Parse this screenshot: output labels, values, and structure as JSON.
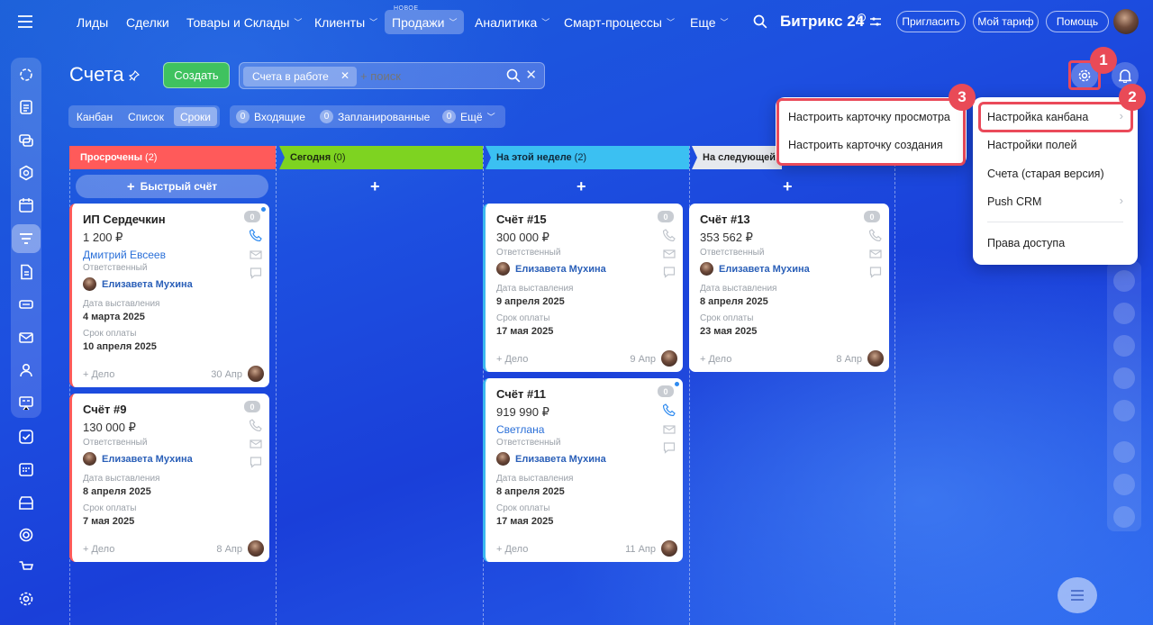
{
  "topnav": {
    "items": [
      {
        "label": "Лиды",
        "chev": ""
      },
      {
        "label": "Сделки",
        "chev": ""
      },
      {
        "label": "Товары и Склады",
        "chev": "﹀"
      },
      {
        "label": "Клиенты",
        "chev": "﹀"
      },
      {
        "label": "Продажи",
        "chev": "﹀"
      },
      {
        "label": "Аналитика",
        "chev": "﹀"
      },
      {
        "label": "Смарт-процессы",
        "chev": "﹀"
      },
      {
        "label": "Еще",
        "chev": "﹀"
      }
    ],
    "new_badge": "НОВОЕ",
    "brand": "Битрикс 24",
    "invite": "Пригласить",
    "tariff": "Мой тариф",
    "help": "Помощь"
  },
  "header": {
    "title": "Счета",
    "create": "Создать",
    "filter_chip": "Счета в работе",
    "search_placeholder": "+ поиск"
  },
  "views": [
    "Канбан",
    "Список",
    "Сроки"
  ],
  "counters": [
    {
      "num": "0",
      "label": "Входящие"
    },
    {
      "num": "0",
      "label": "Запланированные"
    },
    {
      "num": "0",
      "label": "Ещё"
    }
  ],
  "stages": [
    {
      "name": "Просрочены",
      "count": "(2)"
    },
    {
      "name": "Сегодня",
      "count": "(0)"
    },
    {
      "name": "На этой неделе",
      "count": "(2)"
    },
    {
      "name": "На следующей",
      "count": ""
    }
  ],
  "quick_invoice": "Быстрый счёт",
  "labels": {
    "responsible": "Ответственный",
    "issue_date": "Дата выставления",
    "due_date": "Срок оплаты",
    "add_task": "+ Дело"
  },
  "cards": [
    {
      "title": "ИП Сердечкин",
      "badge": "0",
      "sum": "1 200 ₽",
      "client": "Дмитрий Евсеев",
      "resp": "Елизавета Мухина",
      "issue": "4 марта 2025",
      "due": "10 апреля 2025",
      "foot": "30 Апр"
    },
    {
      "title": "Счёт #9",
      "badge": "0",
      "sum": "130 000 ₽",
      "client": "",
      "resp": "Елизавета Мухина",
      "issue": "8 апреля 2025",
      "due": "7 мая 2025",
      "foot": "8 Апр"
    },
    {
      "title": "Счёт #15",
      "badge": "0",
      "sum": "300 000 ₽",
      "client": "",
      "resp": "Елизавета Мухина",
      "issue": "9 апреля 2025",
      "due": "17 мая 2025",
      "foot": "9 Апр"
    },
    {
      "title": "Счёт #11",
      "badge": "0",
      "sum": "919 990 ₽",
      "client": "Светлана",
      "resp": "Елизавета Мухина",
      "issue": "8 апреля 2025",
      "due": "17 мая 2025",
      "foot": "11 Апр"
    },
    {
      "title": "Счёт #13",
      "badge": "0",
      "sum": "353 562 ₽",
      "client": "",
      "resp": "Елизавета Мухина",
      "issue": "8 апреля 2025",
      "due": "23 мая 2025",
      "foot": "8 Апр"
    }
  ],
  "submenu": [
    "Настроить карточку просмотра",
    "Настроить карточку создания"
  ],
  "menu": [
    "Настройка канбана",
    "Настройки полей",
    "Счета (старая версия)",
    "Push CRM",
    "Права доступа"
  ],
  "step_badges": [
    "1",
    "2",
    "3"
  ],
  "colors": {
    "overdue": "#ff5a5a",
    "today": "#7ed321",
    "week": "#3bc0f2",
    "next": "#e6e9ee",
    "highlight": "#ea4a5a"
  }
}
